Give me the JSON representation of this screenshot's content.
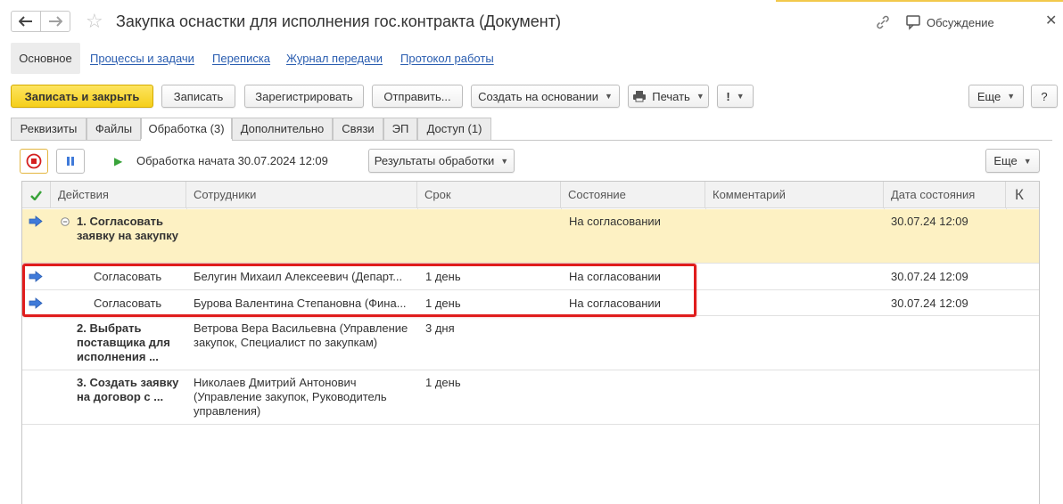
{
  "window": {
    "title": "Закупка оснастки для исполнения гос.контракта (Документ)",
    "discussion_label": "Обсуждение",
    "icons": {
      "back": "arrow-left-icon",
      "forward": "arrow-right-icon",
      "favorite": "star-icon",
      "link": "link-icon",
      "discussion": "chat-icon",
      "close": "close-icon"
    }
  },
  "section_tabs": {
    "active": "Основное",
    "links": [
      "Процессы и задачи",
      "Переписка",
      "Журнал передачи",
      "Протокол работы"
    ]
  },
  "toolbar": {
    "save_close": "Записать и закрыть",
    "save": "Записать",
    "register": "Зарегистрировать",
    "send": "Отправить...",
    "create_based": "Создать на основании",
    "print": "Печать",
    "important": "!",
    "more": "Еще",
    "help": "?"
  },
  "tabs": {
    "items": [
      "Реквизиты",
      "Файлы",
      "Обработка (3)",
      "Дополнительно",
      "Связи",
      "ЭП",
      "Доступ (1)"
    ],
    "active_index": 2
  },
  "processing": {
    "status": "Обработка начата 30.07.2024 12:09",
    "results_button": "Результаты обработки",
    "more": "Еще"
  },
  "table": {
    "columns": {
      "actions": "Действия",
      "employees": "Сотрудники",
      "deadline": "Срок",
      "state": "Состояние",
      "comment": "Комментарий",
      "state_date": "Дата состояния",
      "k": "К"
    },
    "rows": [
      {
        "action": "1. Согласовать заявку на закупку",
        "employee": "",
        "deadline": "",
        "state": "На согласовании",
        "comment": "",
        "date": "30.07.24 12:09"
      },
      {
        "action": "Согласовать",
        "employee": "Белугин Михаил Алексеевич (Департ...",
        "deadline": "1 день",
        "state": "На согласовании",
        "comment": "",
        "date": "30.07.24 12:09"
      },
      {
        "action": "Согласовать",
        "employee": "Бурова Валентина Степановна (Фина...",
        "deadline": "1 день",
        "state": "На согласовании",
        "comment": "",
        "date": "30.07.24 12:09"
      },
      {
        "action": "2. Выбрать поставщика для исполнения ...",
        "employee": "Ветрова Вера Васильевна (Управление закупок, Специалист по закупкам)",
        "deadline": "3 дня",
        "state": "",
        "comment": "",
        "date": ""
      },
      {
        "action": "3. Создать заявку на договор с ...",
        "employee": "Николаев Дмитрий Антонович (Управление закупок, Руководитель управления)",
        "deadline": "1 день",
        "state": "",
        "comment": "",
        "date": ""
      }
    ]
  },
  "colors": {
    "accent_yellow": "#f5cf1a",
    "highlight_row": "#fdf1c3",
    "link_blue": "#2a5db0",
    "red_frame": "#e01c1c",
    "check_green": "#39a33a",
    "arrow_blue": "#3f7ad9"
  }
}
